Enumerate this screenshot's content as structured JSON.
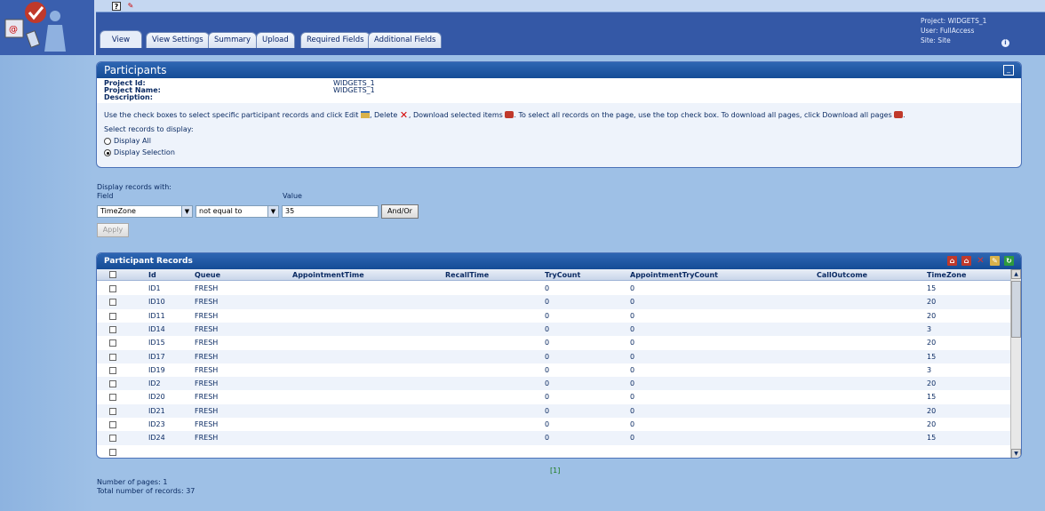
{
  "toolbar": {
    "help_icon": "?",
    "tool_icon": "✎"
  },
  "tabs": [
    {
      "label": "View",
      "active": true
    },
    {
      "label": "View Settings"
    },
    {
      "label": "Summary"
    },
    {
      "label": "Upload"
    },
    {
      "label": "Required Fields"
    },
    {
      "label": "Additional Fields"
    }
  ],
  "user_info": {
    "project": "Project: WIDGETS_1",
    "user": "User: FullAccess",
    "site": "Site: Site"
  },
  "participants": {
    "title": "Participants",
    "project_id_label": "Project Id:",
    "project_id": "WIDGETS_1",
    "project_name_label": "Project Name:",
    "project_name": "WIDGETS_1",
    "description_label": "Description:",
    "instr_1": "Use the check boxes to select specific participant records and click Edit",
    "instr_2": ", Delete",
    "instr_3": ", Download selected items",
    "instr_4": ". To select all records on the page, use the top check box. To download all pages, click Download all pages",
    "instr_5": ".",
    "select_label": "Select records to display:",
    "radio_all": "Display All",
    "radio_selection": "Display Selection"
  },
  "filter": {
    "heading": "Display records with:",
    "field_label": "Field",
    "value_label": "Value",
    "field_value": "TimeZone",
    "operator_value": "not equal to",
    "value": "35",
    "andor_label": "And/Or",
    "apply_label": "Apply"
  },
  "records": {
    "title": "Participant Records",
    "columns": [
      "Id",
      "Queue",
      "AppointmentTime",
      "RecallTime",
      "TryCount",
      "AppointmentTryCount",
      "CallOutcome",
      "TimeZone"
    ],
    "rows": [
      {
        "id": "ID1",
        "queue": "FRESH",
        "try": "0",
        "atry": "0",
        "tz": "15"
      },
      {
        "id": "ID10",
        "queue": "FRESH",
        "try": "0",
        "atry": "0",
        "tz": "20"
      },
      {
        "id": "ID11",
        "queue": "FRESH",
        "try": "0",
        "atry": "0",
        "tz": "20"
      },
      {
        "id": "ID14",
        "queue": "FRESH",
        "try": "0",
        "atry": "0",
        "tz": "3"
      },
      {
        "id": "ID15",
        "queue": "FRESH",
        "try": "0",
        "atry": "0",
        "tz": "20"
      },
      {
        "id": "ID17",
        "queue": "FRESH",
        "try": "0",
        "atry": "0",
        "tz": "15"
      },
      {
        "id": "ID19",
        "queue": "FRESH",
        "try": "0",
        "atry": "0",
        "tz": "3"
      },
      {
        "id": "ID2",
        "queue": "FRESH",
        "try": "0",
        "atry": "0",
        "tz": "20"
      },
      {
        "id": "ID20",
        "queue": "FRESH",
        "try": "0",
        "atry": "0",
        "tz": "15"
      },
      {
        "id": "ID21",
        "queue": "FRESH",
        "try": "0",
        "atry": "0",
        "tz": "20"
      },
      {
        "id": "ID23",
        "queue": "FRESH",
        "try": "0",
        "atry": "0",
        "tz": "20"
      },
      {
        "id": "ID24",
        "queue": "FRESH",
        "try": "0",
        "atry": "0",
        "tz": "15"
      }
    ]
  },
  "pager": "[1]",
  "footer": {
    "pages": "Number of pages: 1",
    "total": "Total number of records: 37"
  }
}
